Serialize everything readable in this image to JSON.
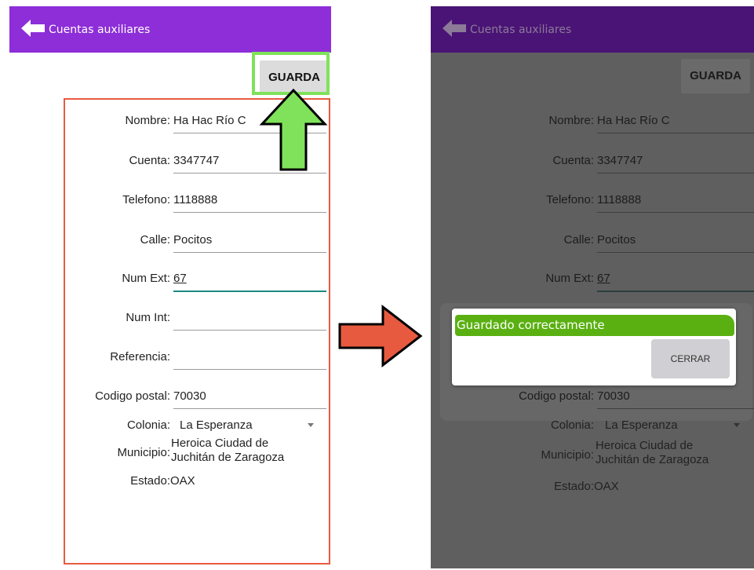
{
  "app": {
    "title": "Cuentas auxiliares",
    "save_label": "GUARDA"
  },
  "form": {
    "nombre": {
      "label": "Nombre:",
      "value": "Ha Hac Río C"
    },
    "cuenta": {
      "label": "Cuenta:",
      "value": "3347747"
    },
    "telefono": {
      "label": "Telefono:",
      "value": "1118888"
    },
    "calle": {
      "label": "Calle:",
      "value": "Pocitos"
    },
    "num_ext": {
      "label": "Num Ext:",
      "value": "67"
    },
    "num_int": {
      "label": "Num Int:",
      "value": ""
    },
    "referencia": {
      "label": "Referencia:",
      "value": ""
    },
    "codigo_postal": {
      "label": "Codigo postal:",
      "value": "70030"
    },
    "colonia": {
      "label": "Colonia:",
      "value": "La Esperanza"
    },
    "municipio": {
      "label": "Municipio:",
      "value_line1": "Heroica Ciudad de",
      "value_line2": "Juchitán de Zaragoza"
    },
    "estado": {
      "label": "Estado:",
      "value": "OAX"
    }
  },
  "dialog": {
    "message": "Guardado correctamente",
    "close_label": "CERRAR"
  },
  "annotations": {
    "save_highlight_color": "#7fe25a",
    "form_highlight_color": "#e85a40",
    "up_arrow_color": "#7fe25a",
    "right_arrow_color": "#e85a40"
  },
  "icons": {
    "back": "arrow-left-icon",
    "dropdown": "chevron-down-icon",
    "callout_up": "arrow-up-icon",
    "callout_right": "arrow-right-icon"
  }
}
